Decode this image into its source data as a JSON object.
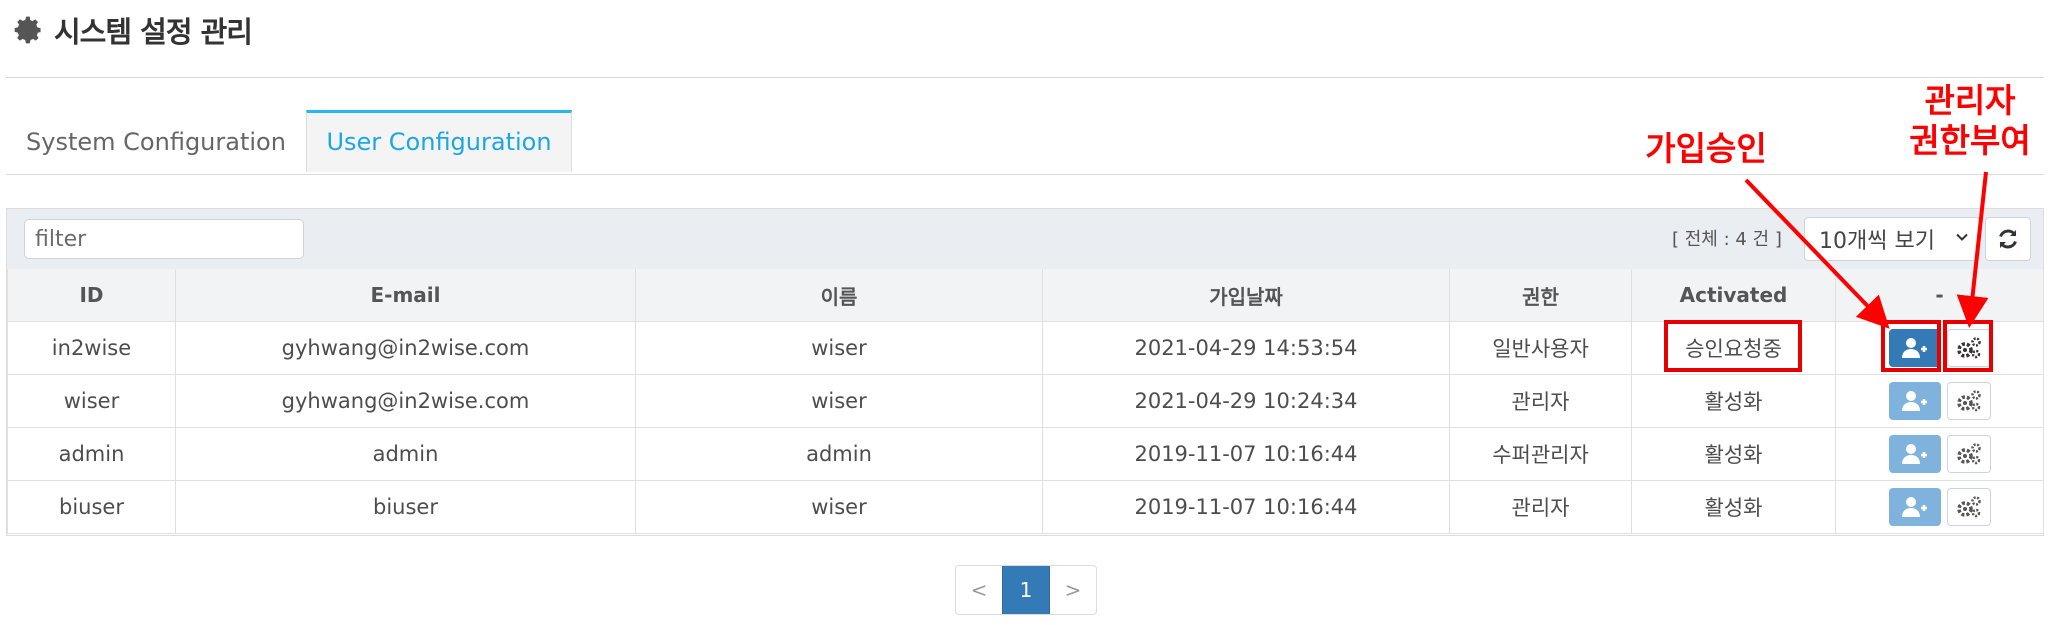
{
  "header": {
    "title": "시스템 설정 관리",
    "icon": "gear-icon"
  },
  "tabs": [
    {
      "label": "System Configuration",
      "active": false
    },
    {
      "label": "User Configuration",
      "active": true
    }
  ],
  "toolbar": {
    "filter_placeholder": "filter",
    "total_count": "[ 전체 : 4 건 ]",
    "page_size": "10개씩 보기",
    "refresh_icon": "refresh-icon"
  },
  "table": {
    "headers": [
      "ID",
      "E-mail",
      "이름",
      "가입날짜",
      "권한",
      "Activated",
      "-"
    ],
    "rows": [
      {
        "id": "in2wise",
        "email": "gyhwang@in2wise.com",
        "name": "wiser",
        "date": "2021-04-29 14:53:54",
        "role": "일반사용자",
        "status": "승인요청중",
        "approve_enabled": true
      },
      {
        "id": "wiser",
        "email": "gyhwang@in2wise.com",
        "name": "wiser",
        "date": "2021-04-29 10:24:34",
        "role": "관리자",
        "status": "활성화",
        "approve_enabled": false
      },
      {
        "id": "admin",
        "email": "admin",
        "name": "admin",
        "date": "2019-11-07 10:16:44",
        "role": "수퍼관리자",
        "status": "활성화",
        "approve_enabled": false
      },
      {
        "id": "biuser",
        "email": "biuser",
        "name": "wiser",
        "date": "2019-11-07 10:16:44",
        "role": "관리자",
        "status": "활성화",
        "approve_enabled": false
      }
    ]
  },
  "pagination": {
    "prev": "<",
    "current": "1",
    "next": ">"
  },
  "annotations": {
    "approve_label": "가입승인",
    "admin_label_line1": "관리자",
    "admin_label_line2": "권한부여",
    "color": "#ff0000"
  },
  "colors": {
    "accent": "#29b6f0",
    "primary": "#337ab7",
    "primary_light": "#7fb2dd"
  }
}
